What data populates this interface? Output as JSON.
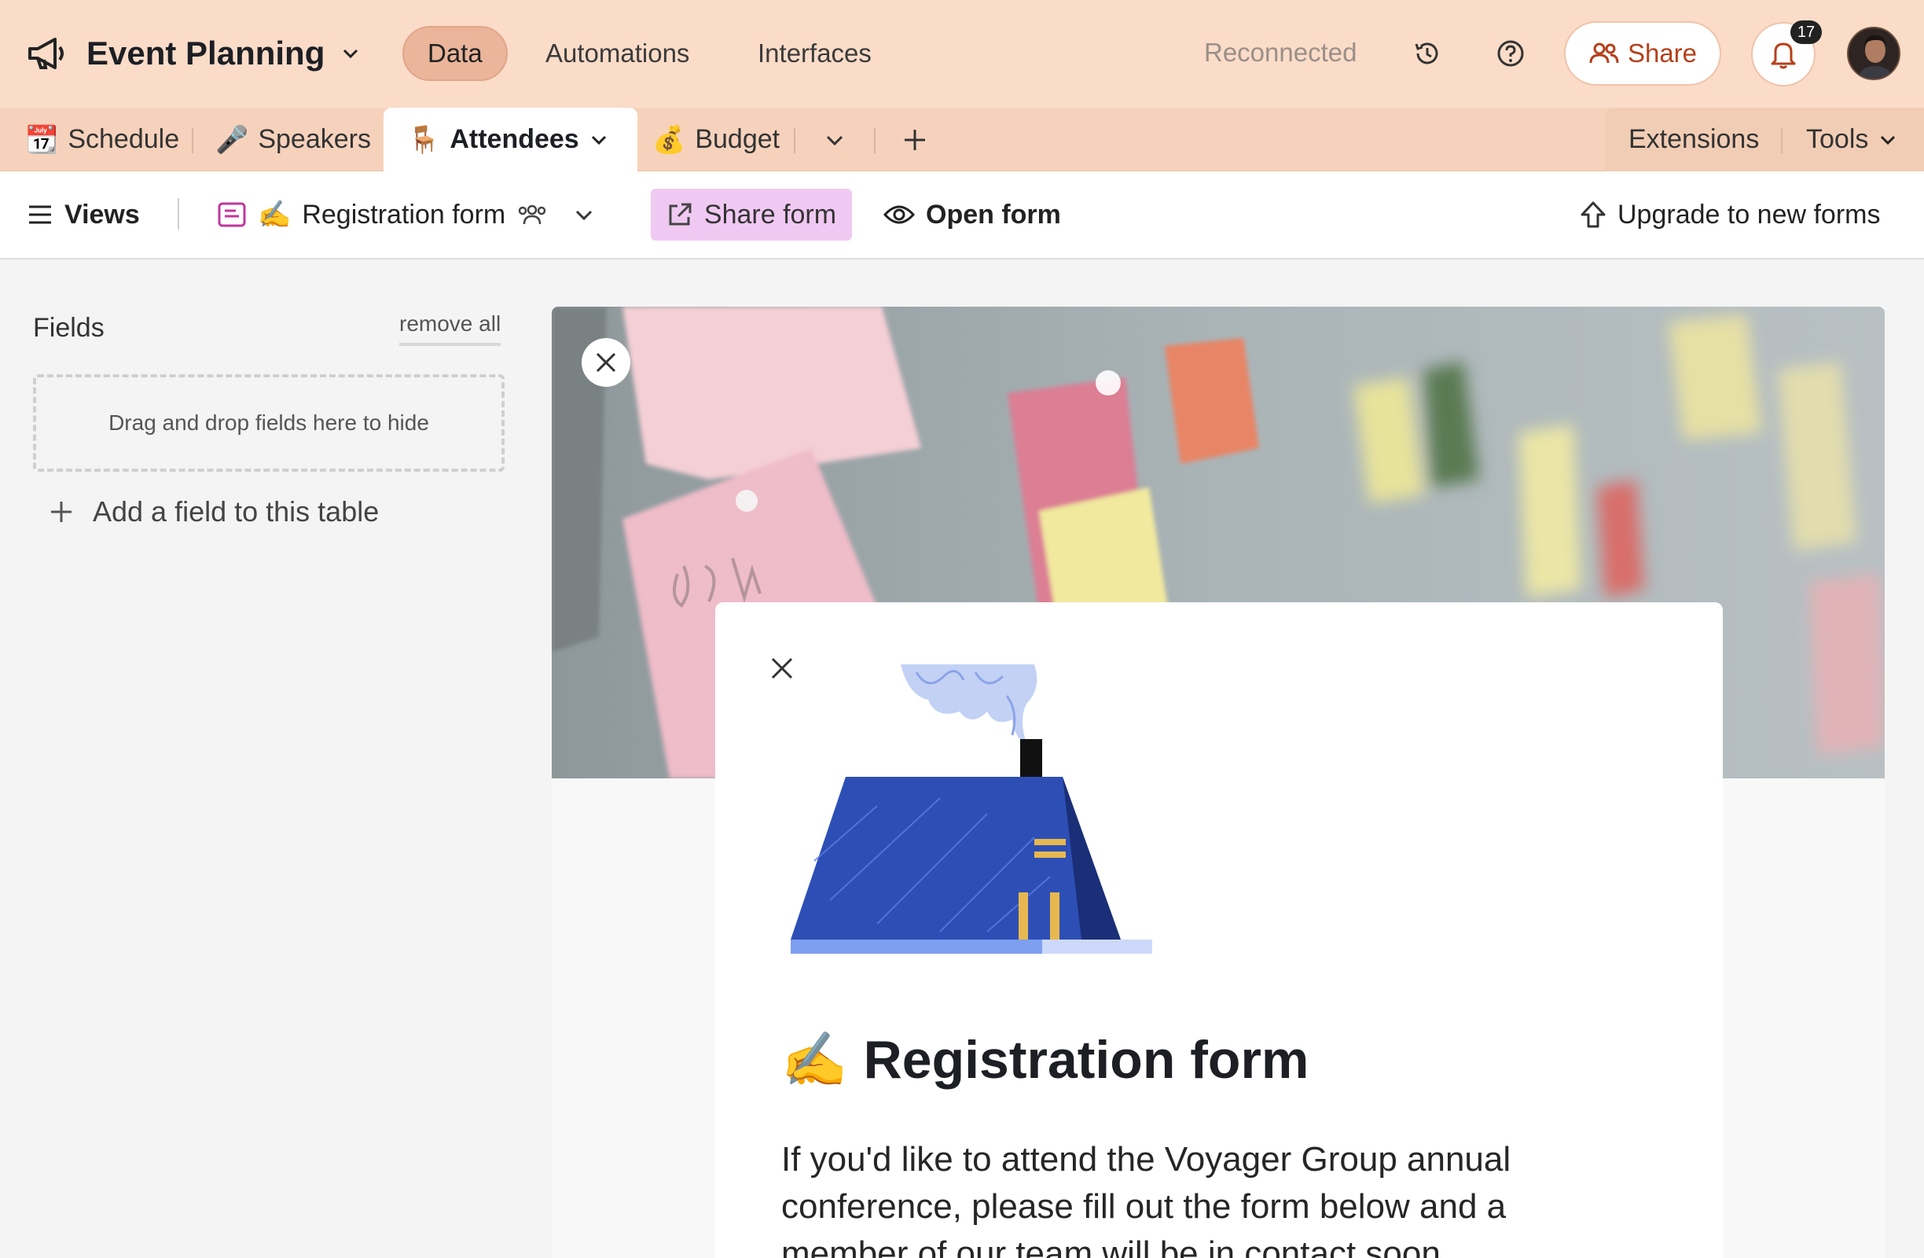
{
  "header": {
    "base_name": "Event Planning",
    "nav": [
      "Data",
      "Automations",
      "Interfaces"
    ],
    "status": "Reconnected",
    "share_label": "Share",
    "notification_count": "17"
  },
  "tabs": {
    "items": [
      {
        "emoji": "📆",
        "label": "Schedule"
      },
      {
        "emoji": "🎤",
        "label": "Speakers"
      },
      {
        "emoji": "🪑",
        "label": "Attendees"
      },
      {
        "emoji": "💰",
        "label": "Budget"
      }
    ],
    "extensions": "Extensions",
    "tools": "Tools"
  },
  "toolbar": {
    "views": "Views",
    "view_emoji": "✍️",
    "view_name": "Registration form",
    "share_form": "Share form",
    "open_form": "Open form",
    "upgrade": "Upgrade to new forms"
  },
  "fields_panel": {
    "title": "Fields",
    "remove_all": "remove all",
    "dropzone": "Drag and drop fields here to hide",
    "add_field": "Add a field to this table"
  },
  "form": {
    "title_emoji": "✍️",
    "title": "Registration form",
    "description": "If you'd like to attend the Voyager Group annual conference, please fill out the form below and a member of our team will be in contact soon."
  },
  "colors": {
    "header_bg": "#fbdcc8",
    "active_nav": "#eab59a",
    "share_text": "#b6401a",
    "share_form_bg": "#f0c9f2"
  }
}
